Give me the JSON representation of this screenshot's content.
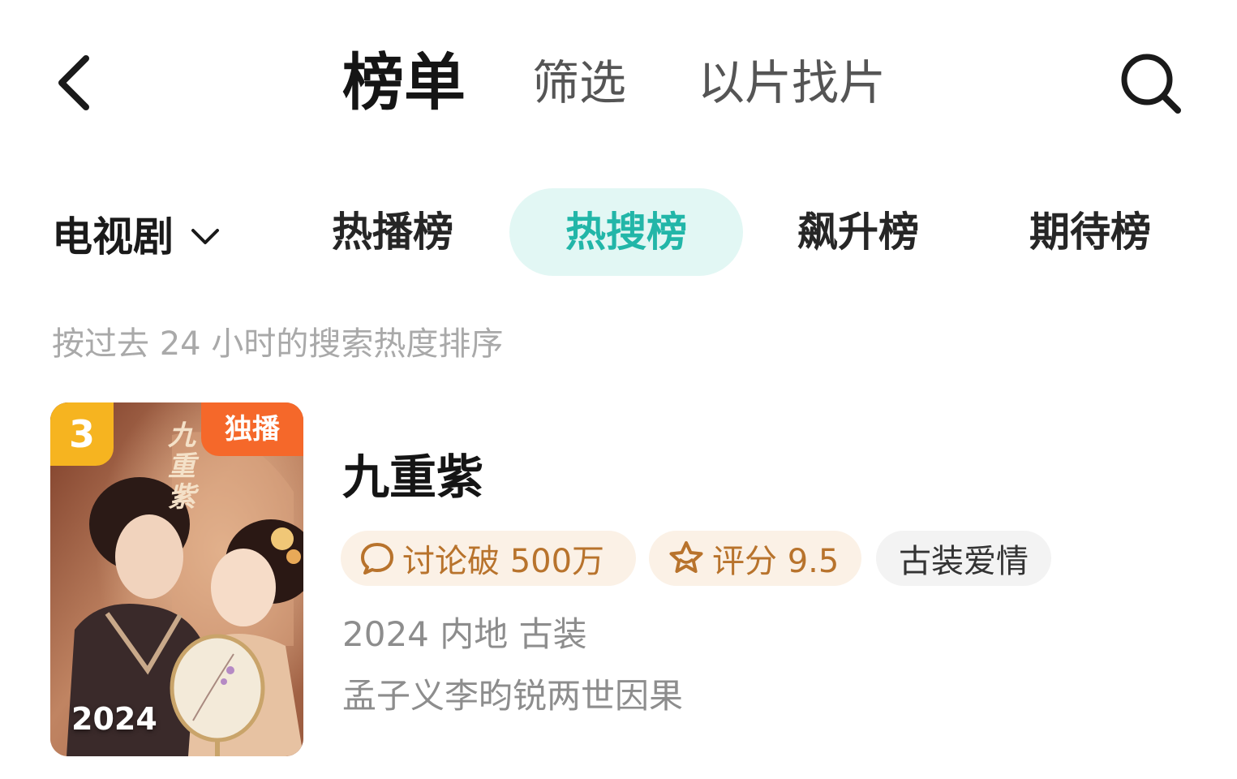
{
  "header": {
    "back_icon": "chevron-left-icon",
    "tabs": [
      {
        "label": "榜单",
        "active": true
      },
      {
        "label": "筛选",
        "active": false
      },
      {
        "label": "以片找片",
        "active": false
      }
    ],
    "search_icon": "search-icon"
  },
  "category": {
    "selected": "电视剧",
    "dropdown_icon": "chevron-down-icon"
  },
  "rank_tabs": [
    {
      "label": "热播榜",
      "selected": false
    },
    {
      "label": "热搜榜",
      "selected": true
    },
    {
      "label": "飙升榜",
      "selected": false
    },
    {
      "label": "期待榜",
      "selected": false
    }
  ],
  "subtitle": "按过去 24 小时的搜索热度排序",
  "items": [
    {
      "rank": "3",
      "exclusive_badge": "独播",
      "poster_year": "2024",
      "poster_calligraphy": "九重紫",
      "title": "九重紫",
      "tags": [
        {
          "icon": "comment-icon",
          "text": "讨论破 500万"
        },
        {
          "icon": "star-icon",
          "text": "评分 9.5"
        },
        {
          "text": "古装爱情"
        }
      ],
      "meta": "2024 内地 古装",
      "description": "孟子义李昀锐两世因果"
    }
  ],
  "colors": {
    "accent": "#22b6a8",
    "accent_bg": "#e2f7f4",
    "rank_badge": "#f6b420",
    "exclusive_badge": "#f5682a",
    "tag_warm_text": "#b8732c",
    "tag_warm_bg": "#fbf1e6"
  }
}
